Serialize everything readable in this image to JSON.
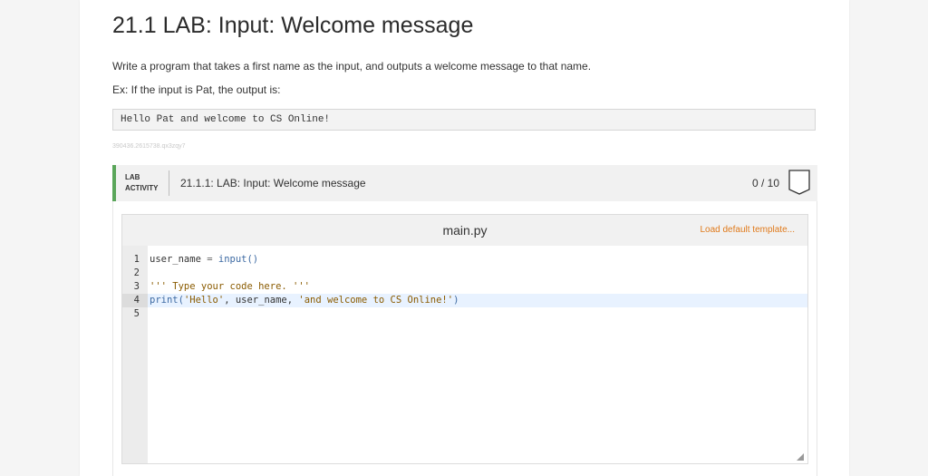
{
  "page": {
    "title": "21.1 LAB: Input: Welcome message",
    "description": "Write a program that takes a first name as the input, and outputs a welcome message to that name.",
    "example_intro": "Ex: If the input is Pat, the output is:",
    "example_output": "Hello Pat and welcome to CS Online!",
    "watermark": "390436.2615738.qx3zqy7"
  },
  "lab": {
    "tag_line1": "LAB",
    "tag_line2": "ACTIVITY",
    "name": "21.1.1: LAB: Input: Welcome message",
    "score": "0 / 10",
    "accent_color": "#5aa65a"
  },
  "editor": {
    "file_name": "main.py",
    "load_template_label": "Load default template...",
    "lines": [
      {
        "number": "1",
        "parts": [
          [
            "var",
            "user_name"
          ],
          [
            "op",
            " = "
          ],
          [
            "fn",
            "input()"
          ]
        ]
      },
      {
        "number": "2",
        "parts": []
      },
      {
        "number": "3",
        "parts": [
          [
            "cmt",
            "''' Type your code here. '''"
          ]
        ]
      },
      {
        "number": "4",
        "parts": [
          [
            "fn",
            "print("
          ],
          [
            "str",
            "'Hello'"
          ],
          [
            "var",
            ", user_name, "
          ],
          [
            "str",
            "'and welcome to CS Online!'"
          ],
          [
            "fn",
            ")"
          ]
        ]
      },
      {
        "number": "5",
        "parts": []
      }
    ],
    "active_line": "4"
  }
}
